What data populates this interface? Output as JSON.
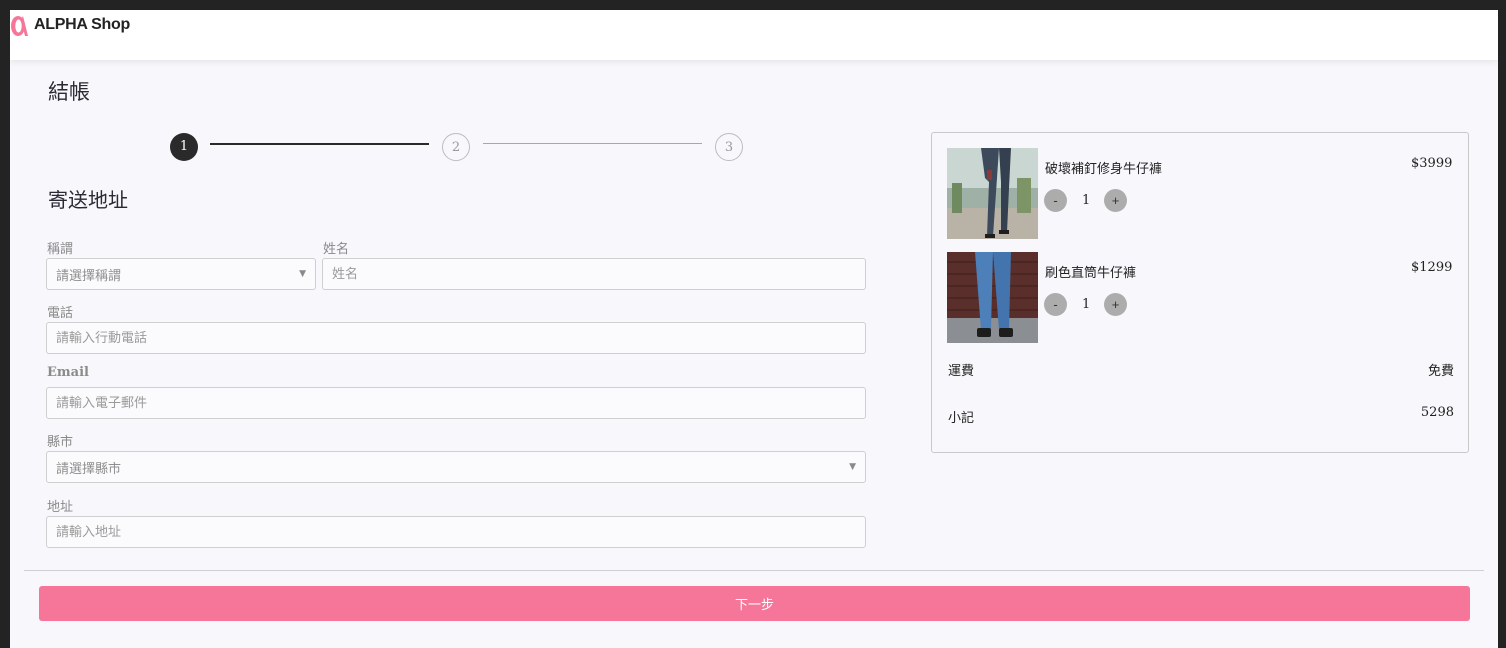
{
  "brand": {
    "name": "ALPHA Shop",
    "accent": "#f6769a"
  },
  "page_title": "結帳",
  "stepper": {
    "steps": [
      "1",
      "2",
      "3"
    ],
    "current": 1
  },
  "section_title": "寄送地址",
  "form": {
    "salutation": {
      "label": "稱謂",
      "placeholder": "請選擇稱謂"
    },
    "name": {
      "label": "姓名",
      "placeholder": "姓名"
    },
    "phone": {
      "label": "電話",
      "placeholder": "請輸入行動電話"
    },
    "email": {
      "label": "Email",
      "placeholder": "請輸入電子郵件"
    },
    "city": {
      "label": "縣市",
      "placeholder": "請選擇縣市"
    },
    "address": {
      "label": "地址",
      "placeholder": "請輸入地址"
    }
  },
  "cart": {
    "items": [
      {
        "name": "破壞補釘修身牛仔褲",
        "price": "$3999",
        "quantity": "1",
        "minus": "-",
        "plus": "+"
      },
      {
        "name": "刷色直筒牛仔褲",
        "price": "$1299",
        "quantity": "1",
        "minus": "-",
        "plus": "+"
      }
    ],
    "shipping": {
      "label": "運費",
      "value": "免費"
    },
    "subtotal": {
      "label": "小記",
      "value": "5298"
    }
  },
  "next_button": "下一步"
}
